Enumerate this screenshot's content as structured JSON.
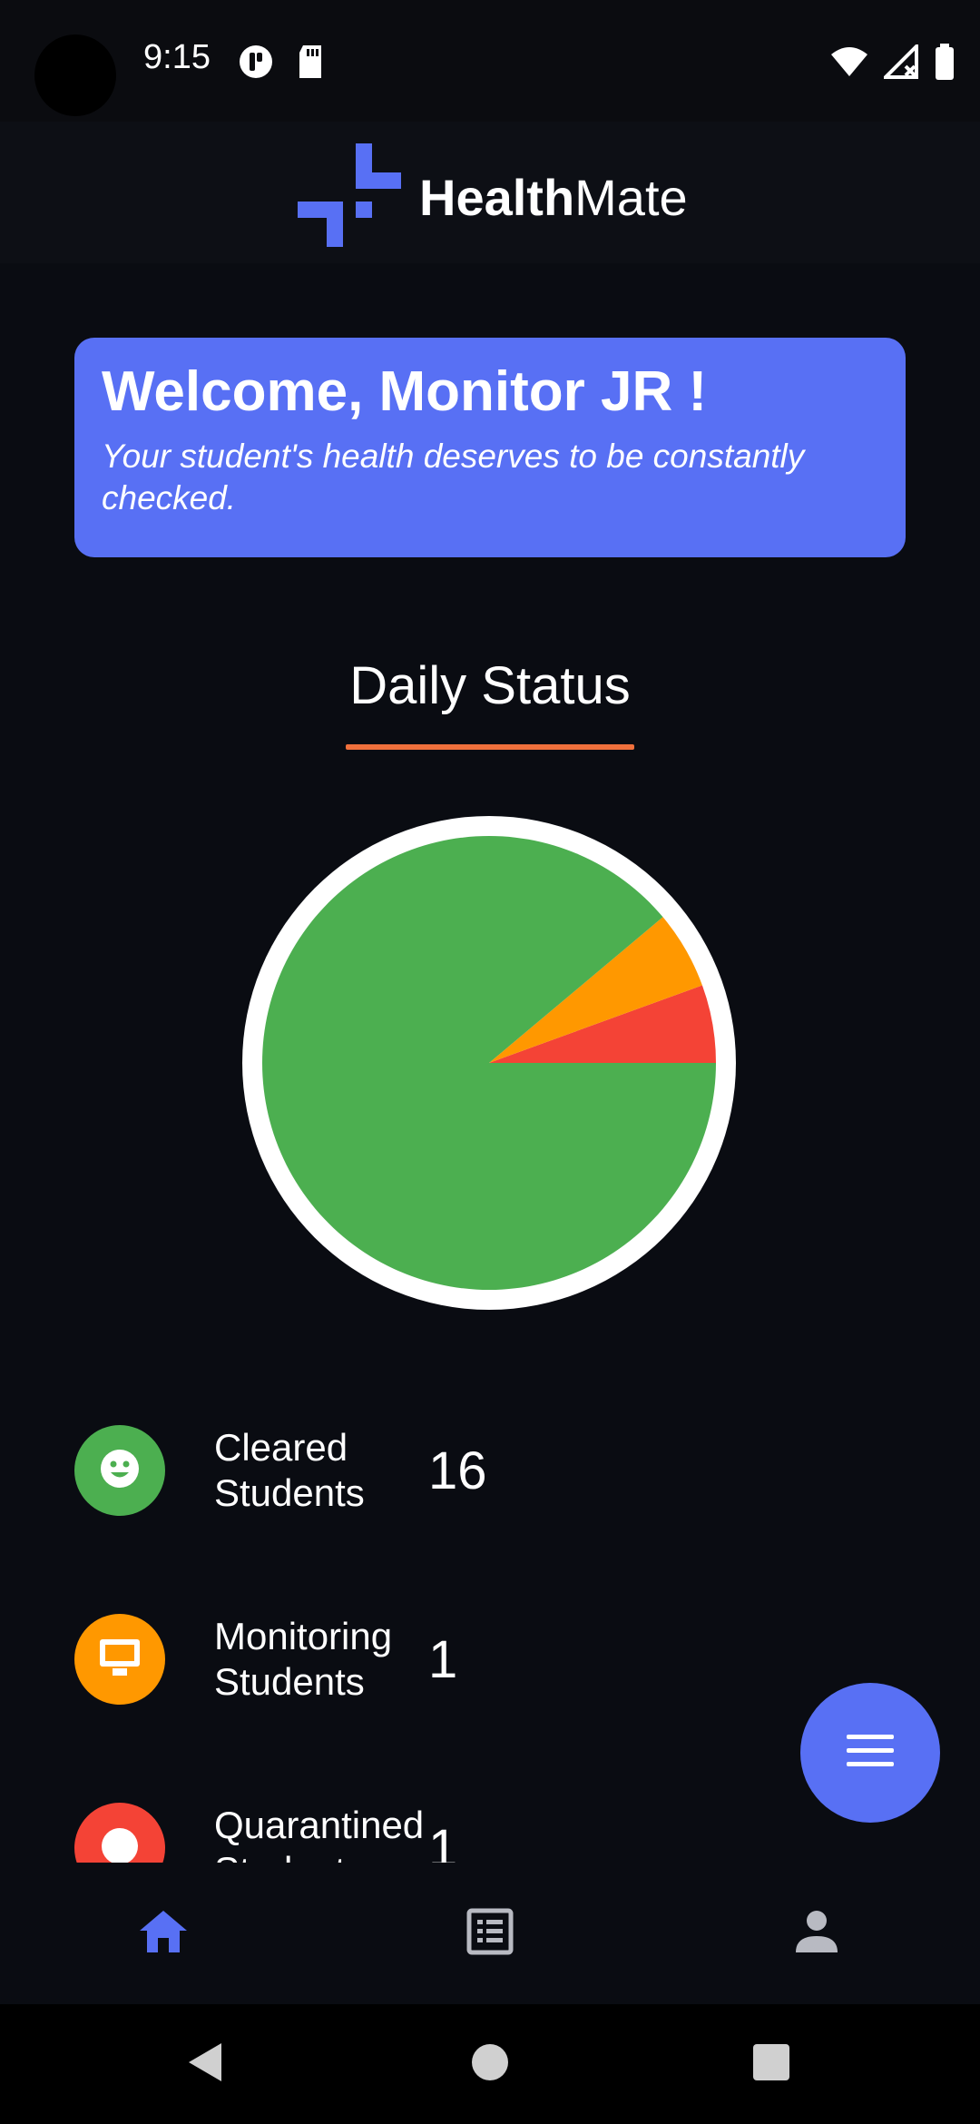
{
  "status_bar": {
    "time": "9:15"
  },
  "header": {
    "brand_bold": "Health",
    "brand_light": "Mate",
    "accent_color": "#5870f4"
  },
  "welcome": {
    "title": "Welcome, Monitor JR !",
    "subtitle": "Your student's health deserves to be constantly checked."
  },
  "daily_status": {
    "title": "Daily Status",
    "underline_color": "#f0703c"
  },
  "chart_data": {
    "type": "pie",
    "categories": [
      "Cleared Students",
      "Monitoring Students",
      "Quarantined Students"
    ],
    "values": [
      16,
      1,
      1
    ],
    "colors": [
      "#4caf50",
      "#ff9800",
      "#f44336"
    ],
    "title": "Daily Status"
  },
  "stats": [
    {
      "label_line1": "Cleared",
      "label_line2": "Students",
      "value": "16",
      "color": "#4caf50",
      "icon": "smiley-face-icon"
    },
    {
      "label_line1": "Monitoring",
      "label_line2": "Students",
      "value": "1",
      "color": "#ff9800",
      "icon": "monitor-icon"
    },
    {
      "label_line1": "Quarantined",
      "label_line2": "Students",
      "value": "1",
      "color": "#f44336",
      "icon": "quarantine-icon"
    }
  ],
  "fab": {
    "icon": "menu-icon"
  },
  "bottom_nav": {
    "items": [
      {
        "icon": "home-icon",
        "active": true
      },
      {
        "icon": "list-icon",
        "active": false
      },
      {
        "icon": "person-icon",
        "active": false
      }
    ]
  }
}
